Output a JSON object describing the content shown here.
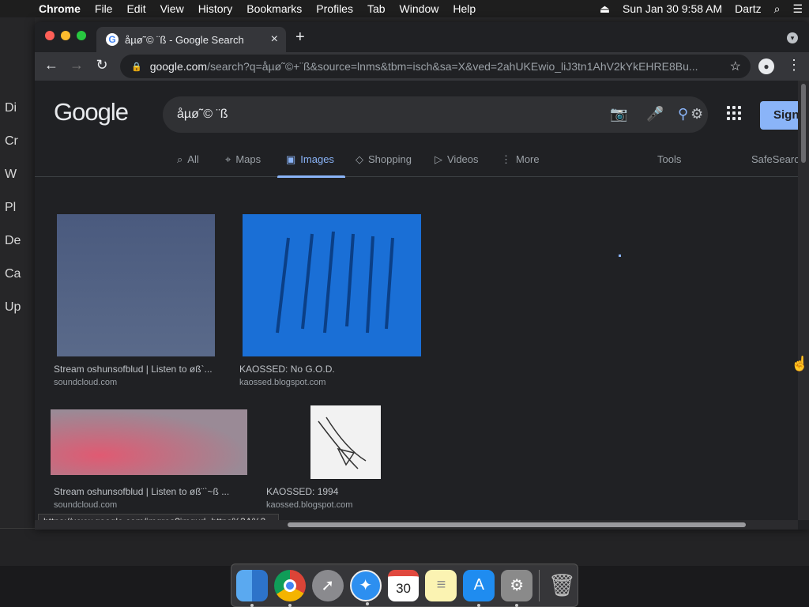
{
  "menubar": {
    "app": "Chrome",
    "items": [
      "File",
      "Edit",
      "View",
      "History",
      "Bookmarks",
      "Profiles",
      "Tab",
      "Window",
      "Help"
    ],
    "clock": "Sun Jan 30  9:58 AM",
    "user": "Dartz"
  },
  "background_sidebar": [
    "Di",
    "Cr",
    "W",
    "Pl",
    "De",
    "Ca",
    "Up"
  ],
  "browser": {
    "tab_title": "åµø˜© ¨ß - Google Search",
    "url_host": "google.com",
    "url_path": "/search?q=åµø˜©+¨ß&source=lnms&tbm=isch&sa=X&ved=2ahUKEwio_liJ3tn1AhV2kYkEHRE8Bu..."
  },
  "google": {
    "logo": "Google",
    "query": "åµø˜© ¨ß",
    "signin": "Sign",
    "tabs": [
      {
        "label": "All",
        "icon": "search-icon"
      },
      {
        "label": "Maps",
        "icon": "map-pin-icon"
      },
      {
        "label": "Images",
        "icon": "image-icon"
      },
      {
        "label": "Shopping",
        "icon": "tag-icon"
      },
      {
        "label": "Videos",
        "icon": "play-icon"
      },
      {
        "label": "More",
        "icon": "more-vert-icon"
      }
    ],
    "tools": "Tools",
    "safesearch": "SafeSearch"
  },
  "results": [
    {
      "title": "Stream oshunsofblud | Listen to øß`...",
      "site": "soundcloud.com",
      "color": "#4a5a7e"
    },
    {
      "title": "KAOSSED: No G.O.D.",
      "site": "kaossed.blogspot.com",
      "color": "#1a6fd6"
    },
    {
      "title": "Stream oshunsofblud | Listen to øß¨`~ß ...",
      "site": "soundcloud.com",
      "color": "#d45c74"
    },
    {
      "title": "KAOSSED: 1994",
      "site": "kaossed.blogspot.com",
      "color": "#f2f2f2"
    }
  ],
  "status_url": "https://www.google.com/imgres?imgurl=https%3A%2...",
  "dock": [
    {
      "name": "finder-icon",
      "color": "#3b82d6",
      "glyph": "☺"
    },
    {
      "name": "chrome-icon",
      "color": "#e8e8e8",
      "glyph": "◉"
    },
    {
      "name": "launchpad-icon",
      "color": "#6b6b6b",
      "glyph": "🚀"
    },
    {
      "name": "safari-icon",
      "color": "#2d8ff0",
      "glyph": "✦"
    },
    {
      "name": "calendar-icon",
      "color": "#ffffff",
      "glyph": "30"
    },
    {
      "name": "notes-icon",
      "color": "#f5e27a",
      "glyph": "≡"
    },
    {
      "name": "app-store-icon",
      "color": "#1f8cf0",
      "glyph": "A"
    },
    {
      "name": "system-preferences-icon",
      "color": "#8a8a8a",
      "glyph": "⚙"
    },
    {
      "name": "trash-icon",
      "color": "#777777",
      "glyph": "🗑"
    }
  ]
}
